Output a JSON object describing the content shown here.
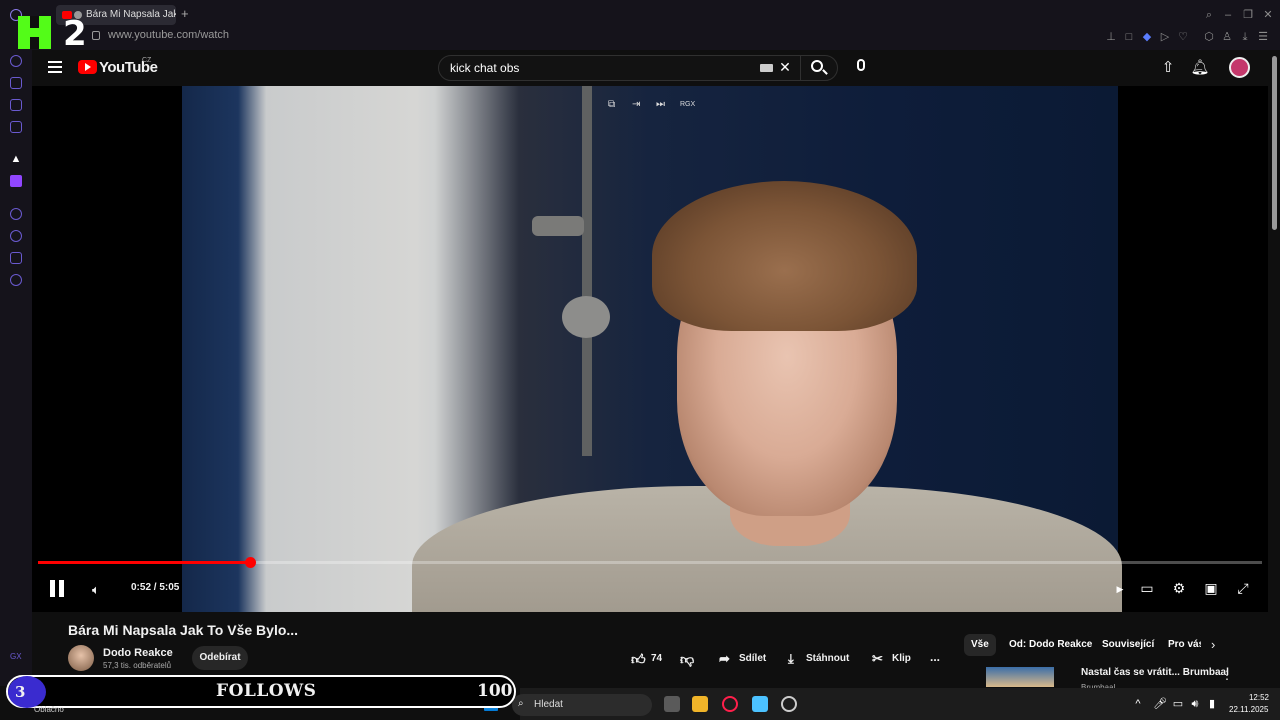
{
  "browser": {
    "tab_title": "Bára Mi Napsala Jak T",
    "new_tab": "+",
    "url": "www.youtube.com/watch"
  },
  "overlay": {
    "kick_number": "2",
    "follows_level": "3",
    "follows_label": "FOLLOWS",
    "follows_count": "100",
    "weather": "Oblačno"
  },
  "youtube": {
    "logo_text": "YouTube",
    "region": "CZ",
    "search_value": "kick chat obs",
    "search_placeholder": "Hledat"
  },
  "video": {
    "time_current": "0:52",
    "time_total": "5:05",
    "time_display": "0:52 / 5:05",
    "progress_fraction": 0.173,
    "pip_label": "RGX",
    "title": "Bára Mi Napsala Jak To Vše Bylo...",
    "channel": "Dodo Reakce",
    "subscribers": "57,3 tis. odběratelů",
    "subscribe_label": "Odebírat",
    "likes": "74",
    "share_label": "Sdílet",
    "download_label": "Stáhnout",
    "clip_label": "Klip",
    "more_label": "..."
  },
  "chips": [
    "Vše",
    "Od: Dodo Reakce",
    "Související",
    "Pro vás"
  ],
  "recommendation": {
    "title": "Nastal čas se vrátit... Brumbaal",
    "channel": "Brumbaal"
  },
  "taskbar": {
    "search_label": "Hledat",
    "time": "12:52",
    "date": "22.11.2025"
  },
  "colors": {
    "accent_red": "#ff0000",
    "kick_green": "#53fc18",
    "follows_circle": "#3a2bcf"
  }
}
